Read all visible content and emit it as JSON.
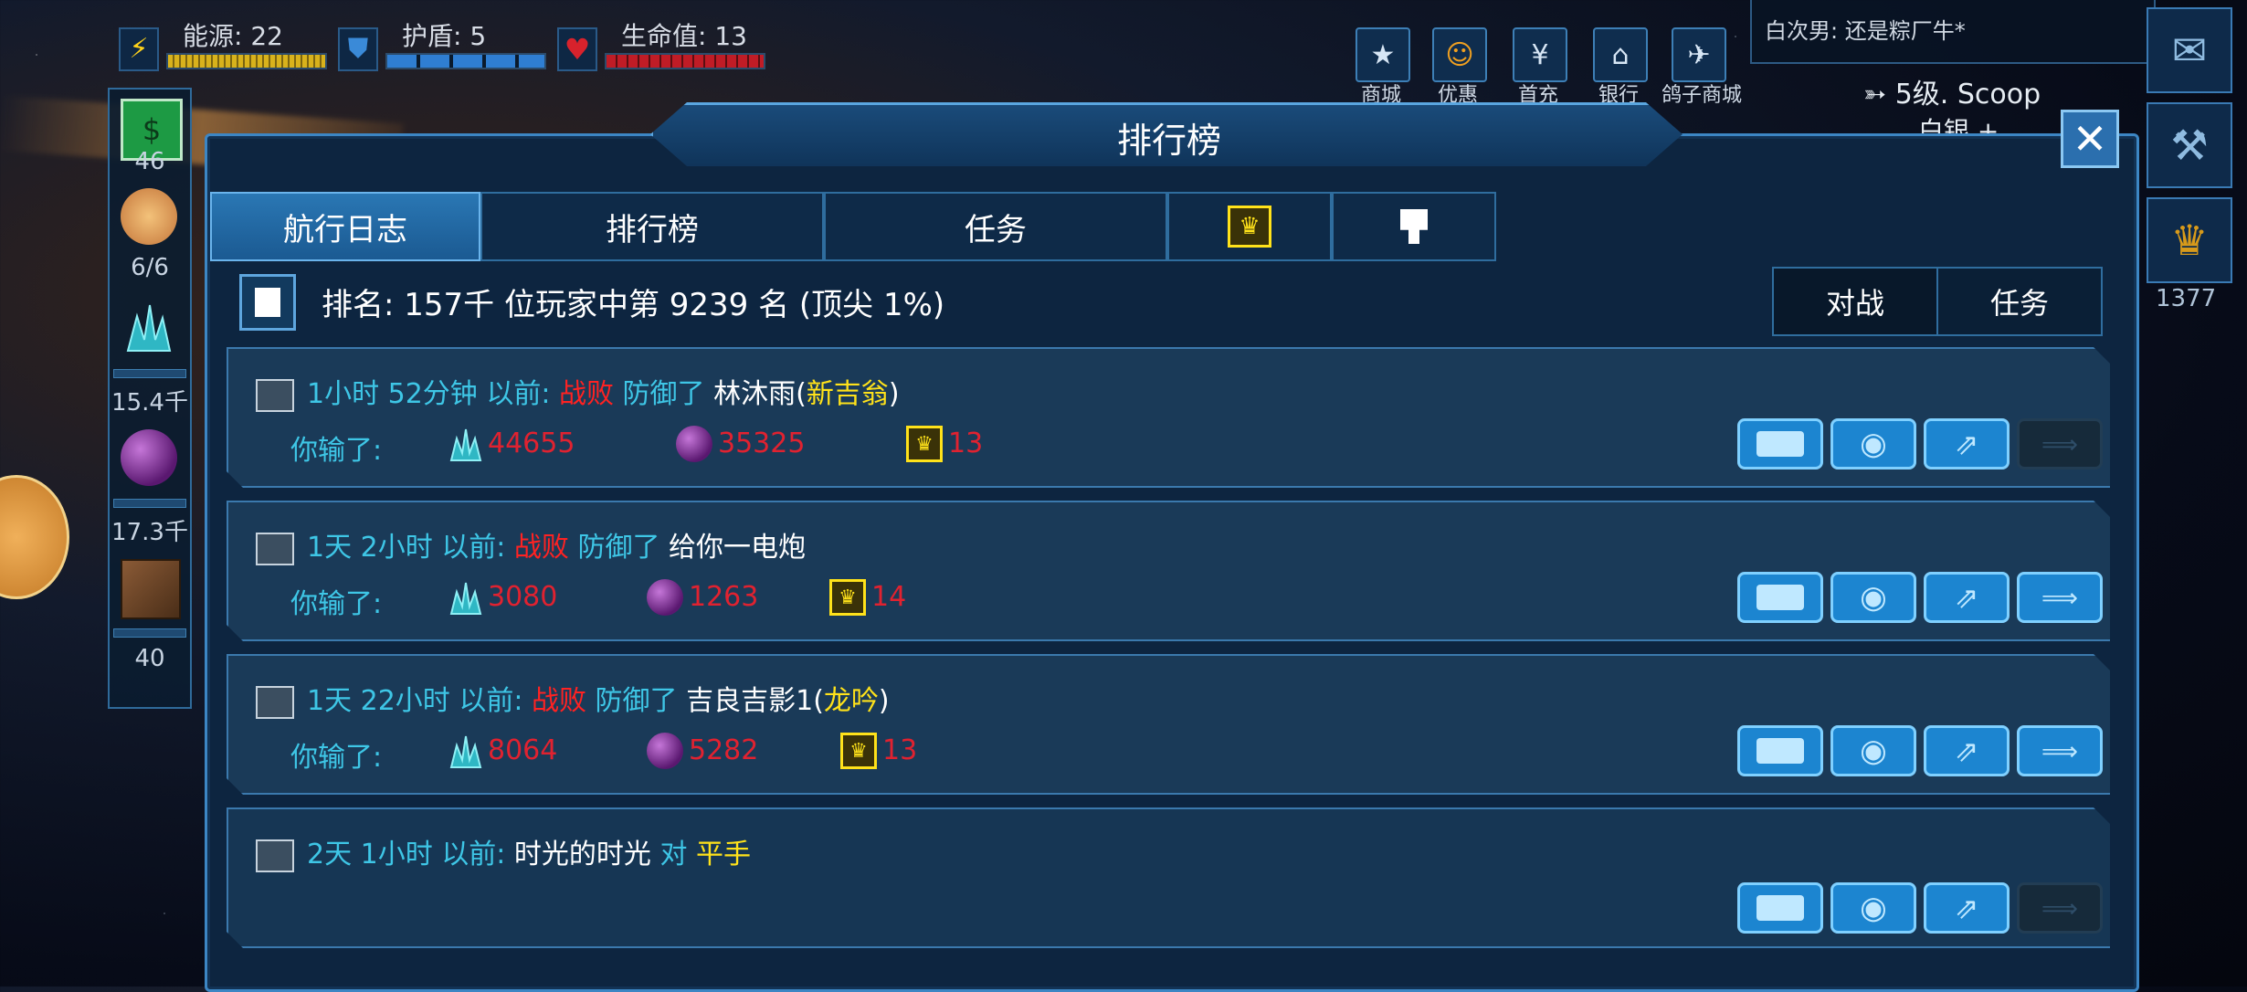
{
  "hud": {
    "energy": {
      "label": "能源: 22",
      "fraction": 1.0
    },
    "shield": {
      "label": "护盾: 5",
      "fraction": 1.0
    },
    "health": {
      "label": "生命值: 13",
      "fraction": 1.0
    }
  },
  "left_column": {
    "credits": "46",
    "crew": "6/6",
    "crystal": "15.4千",
    "orb": "17.3千",
    "cargo": "40"
  },
  "shop_buttons": [
    "商城",
    "优惠",
    "首充",
    "银行",
    "鸽子商城"
  ],
  "chat": {
    "message": "白次男: 还是粽厂牛*"
  },
  "player": {
    "level_name": "5级. Scoop",
    "sub": "白银 +"
  },
  "side_number": "1377",
  "panel": {
    "title": "排行榜",
    "tabs": [
      "航行日志",
      "排行榜",
      "任务"
    ],
    "rank_text": "排名: 157千 位玩家中第 9239 名 (顶尖 1%)",
    "segments": [
      "对战",
      "任务"
    ]
  },
  "log_entries": [
    {
      "time": "1小时 52分钟 以前:",
      "result": "战败",
      "action": "防御了",
      "opponent": "林沐雨",
      "guild": "新吉翁",
      "lost_label": "你输了:",
      "crystal": "44655",
      "orb": "35325",
      "trophy": "13",
      "attack_enabled": false
    },
    {
      "time": "1天 2小时 以前:",
      "result": "战败",
      "action": "防御了",
      "opponent": "给你一电炮",
      "guild": "",
      "lost_label": "你输了:",
      "crystal": "3080",
      "orb": "1263",
      "trophy": "14",
      "attack_enabled": true
    },
    {
      "time": "1天 22小时 以前:",
      "result": "战败",
      "action": "防御了",
      "opponent": "吉良吉影1",
      "guild": "龙吟",
      "lost_label": "你输了:",
      "crystal": "8064",
      "orb": "5282",
      "trophy": "13",
      "attack_enabled": true
    },
    {
      "time": "2天 1小时 以前:",
      "opponent": "时光的时光",
      "versus": "对",
      "result": "平手",
      "attack_enabled": false
    }
  ],
  "colors": {
    "accent": "#3ec6e6",
    "loss": "#e02230",
    "highlight": "#ffe21a",
    "panel": "#0d2540"
  }
}
